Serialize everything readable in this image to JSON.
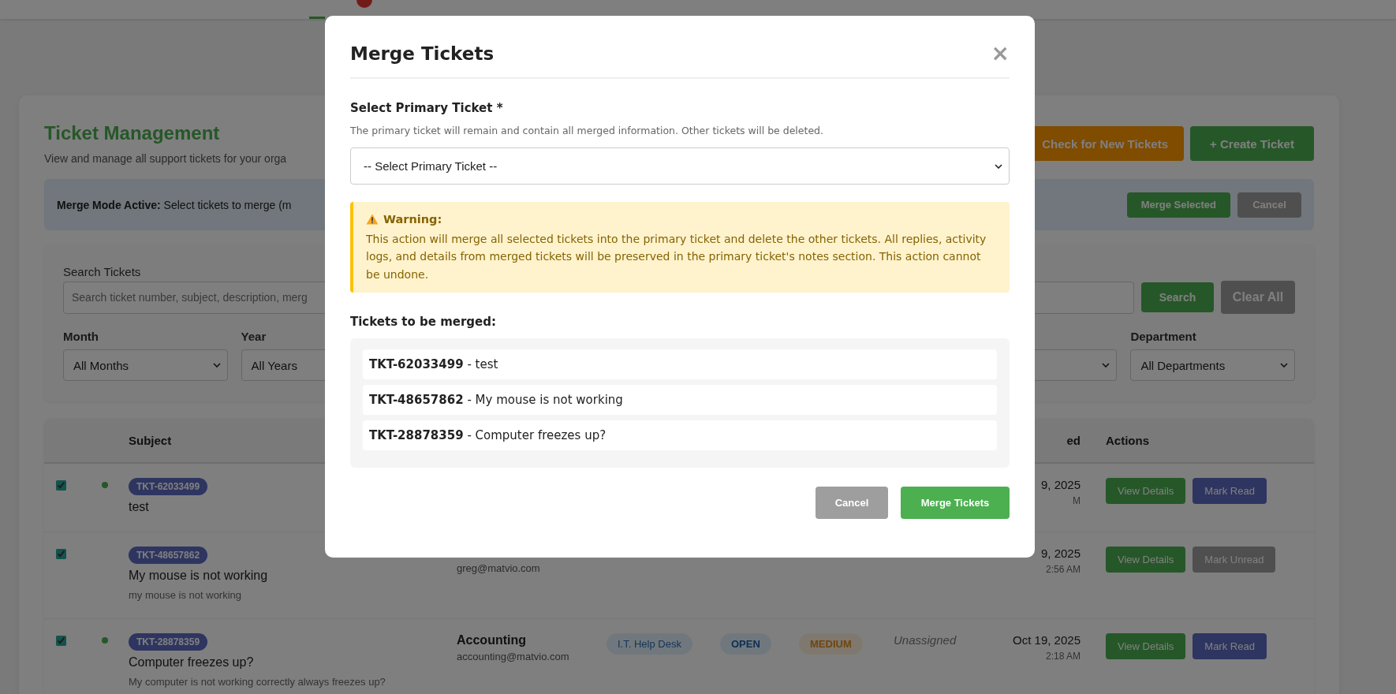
{
  "page": {
    "title": "Ticket Management",
    "subtitle": "View and manage all support tickets for your orga",
    "actions": [
      {
        "label": "Check for New Tickets",
        "kind": "check"
      },
      {
        "label": "+ Create Ticket",
        "kind": "create"
      }
    ]
  },
  "merge_bar": {
    "message": "**Merge Mode Active:** Select tickets to merge (m",
    "buttons": [
      {
        "label": "Merge Selected",
        "kind": "primary"
      },
      {
        "label": "Cancel",
        "kind": "secondary"
      }
    ]
  },
  "search": {
    "label": "Search Tickets",
    "placeholder": "Search ticket number, subject, description, merg",
    "buttons": [
      {
        "label": "Search",
        "kind": "primary"
      },
      {
        "label": "Clear All",
        "kind": "secondary"
      }
    ]
  },
  "filters": [
    {
      "label": "Month",
      "value": "All Months"
    },
    {
      "label": "Year",
      "value": "All Years"
    },
    {
      "label": "Department",
      "value": "All Departments"
    }
  ],
  "table": {
    "columns": [
      {
        "label": "Subject"
      },
      {
        "label": "ed"
      },
      {
        "label": "Actions"
      }
    ],
    "rows": [
      {
        "selected": true,
        "unread": true,
        "ticket": "TKT-62033499",
        "subject": "test",
        "date": "9, 2025",
        "time": "M",
        "actions": [
          {
            "label": "View Details",
            "kind": "view"
          },
          {
            "label": "Mark Read",
            "kind": "read"
          }
        ]
      },
      {
        "selected": true,
        "unread": false,
        "ticket": "TKT-48657862",
        "subject": "My mouse is not working",
        "description": "my mouse is not working",
        "from_email": "greg@matvio.com",
        "date": "9, 2025",
        "time": "2:56 AM",
        "actions": [
          {
            "label": "View Details",
            "kind": "view"
          },
          {
            "label": "Mark Unread",
            "kind": "unread"
          }
        ]
      },
      {
        "selected": true,
        "unread": true,
        "ticket": "TKT-28878359",
        "subject": "Computer freezes up?",
        "description": "My computer is not working correctly always freezes up?",
        "from_name": "Accounting",
        "from_email": "accounting@matvio.com",
        "department": "I.T. Help Desk",
        "status": "OPEN",
        "priority": "MEDIUM",
        "assigned": "Unassigned",
        "date": "Oct 19, 2025",
        "time": "2:18 AM",
        "actions": [
          {
            "label": "View Details",
            "kind": "view"
          },
          {
            "label": "Mark Read",
            "kind": "read"
          }
        ]
      }
    ]
  },
  "modal": {
    "title": "Merge Tickets",
    "close": "×",
    "field_label": "Select Primary Ticket *",
    "help": "The primary ticket will remain and contain all merged information. Other tickets will be deleted.",
    "select_value": "-- Select Primary Ticket --",
    "warning": {
      "title": "Warning:",
      "text": "This action will merge all selected tickets into the primary ticket and delete the other tickets. All replies, activity logs, and details from merged tickets will be preserved in the primary ticket's notes section. This action cannot be undone."
    },
    "list_title": "Tickets to be merged:",
    "tickets": [
      "**TKT-62033499** - test",
      "**TKT-48657862** - My mouse is not working",
      "**TKT-28878359** - Computer freezes up?"
    ],
    "buttons": [
      {
        "label": "Cancel",
        "kind": "secondary"
      },
      {
        "label": "Merge Tickets",
        "kind": "primary"
      }
    ]
  }
}
